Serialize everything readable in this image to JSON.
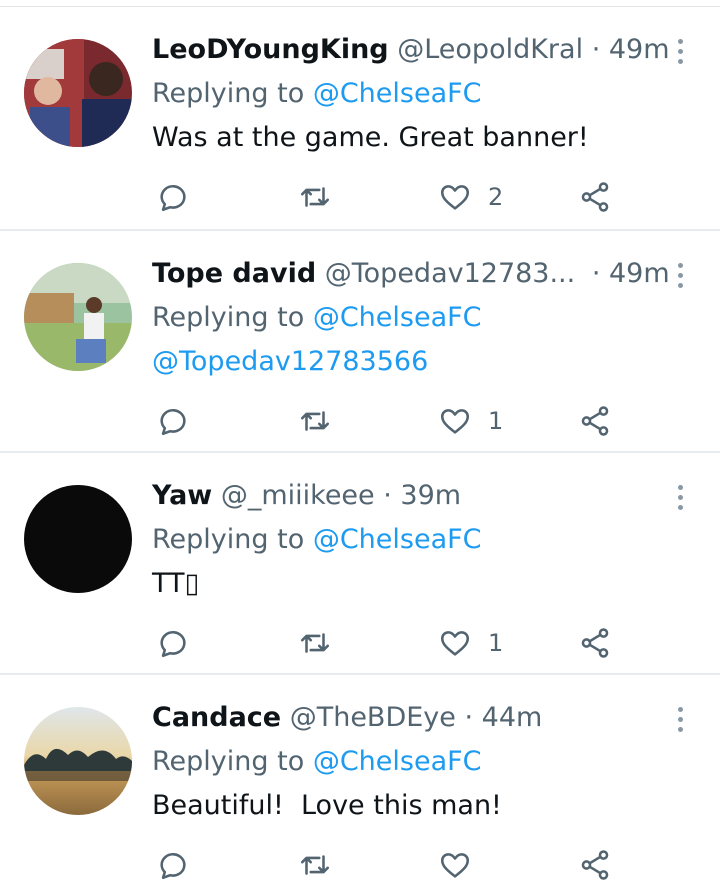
{
  "icons": {
    "reply": "reply-icon",
    "retweet": "retweet-icon",
    "like": "heart-icon",
    "share": "share-icon",
    "more": "more-vertical-icon"
  },
  "colors": {
    "link": "#1d9bf0",
    "muted": "#536471",
    "text": "#0f1419"
  },
  "tweets": [
    {
      "name": "LeoDYoungKing",
      "handle": "@LeopoldKral",
      "time": "· 49m",
      "replying_prefix": "Replying to",
      "replying_to": "@ChelseaFC",
      "text": "Was at the game. Great banner!",
      "likes": "2"
    },
    {
      "name": "Tope david",
      "handle": "@Topedav12783...",
      "time": "· 49m",
      "replying_prefix": "Replying to",
      "replying_to": "@ChelseaFC",
      "text": "@Topedav12783566",
      "likes": "1"
    },
    {
      "name": "Yaw",
      "handle": "@_miiikeee",
      "time": "· 39m",
      "replying_prefix": "Replying to",
      "replying_to": "@ChelseaFC",
      "text": "TT▯",
      "likes": "1"
    },
    {
      "name": "Candace",
      "handle": "@TheBDEye",
      "time": "· 44m",
      "replying_prefix": "Replying to",
      "replying_to": "@ChelseaFC",
      "text": "Beautiful!  Love this man!",
      "likes": ""
    }
  ]
}
